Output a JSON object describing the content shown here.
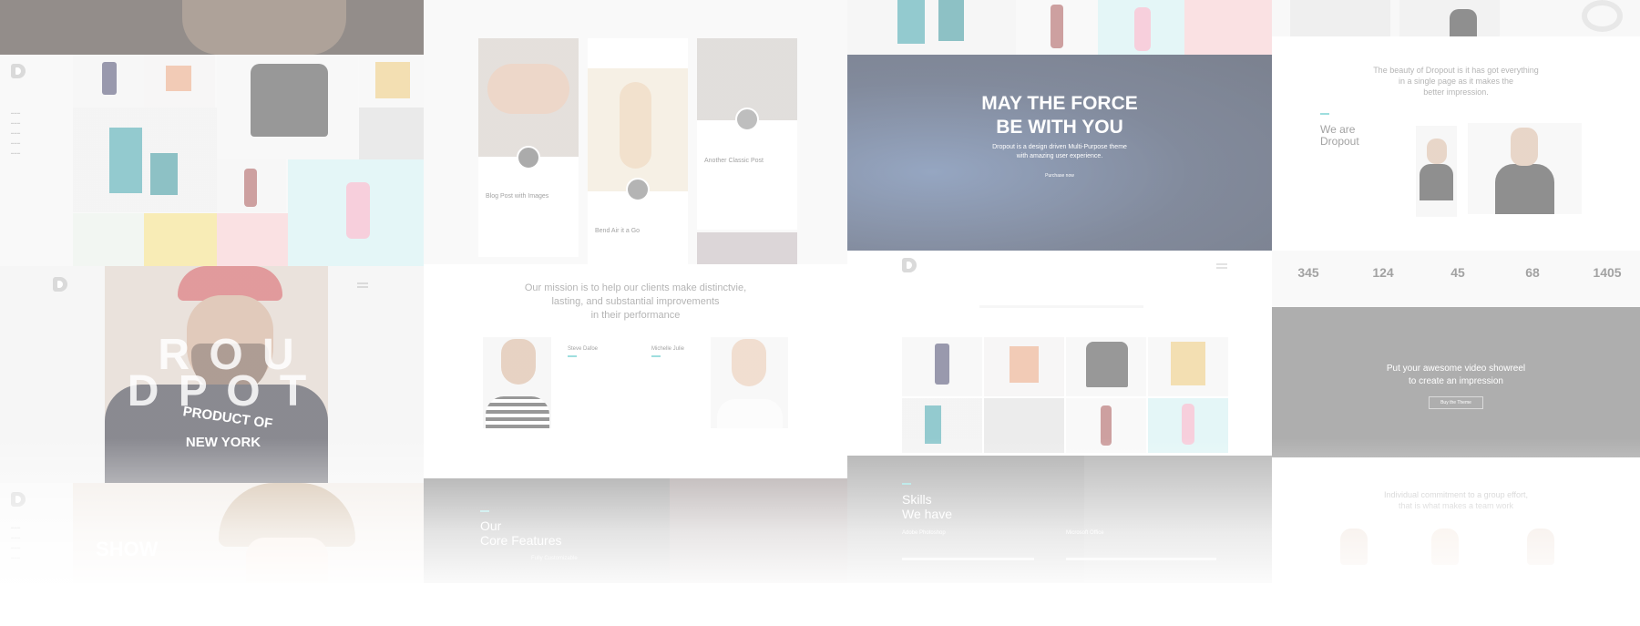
{
  "hero_panel": {
    "title_line1": "MAY THE FORCE",
    "title_line2": "BE WITH YOU",
    "subtitle_line1": "Dropout is a design driven Multi-Purpose theme",
    "subtitle_line2": "with amazing user experience.",
    "cta": "Purchase now"
  },
  "about_panel": {
    "intro_line1": "The beauty of Dropout is it has got everything",
    "intro_line2": "in a single page as it makes the",
    "intro_line3": "better impression.",
    "heading_line1": "We are",
    "heading_line2": "Dropout"
  },
  "stats": [
    "345",
    "124",
    "45",
    "68",
    "1405"
  ],
  "video_panel": {
    "line1": "Put your awesome video showreel",
    "line2": "to create an impression",
    "button": "Buy the Theme"
  },
  "team_panel": {
    "line1": "Individual commitment to a group effort,",
    "line2": "that is what makes a team work"
  },
  "mission_panel": {
    "line1": "Our mission is to help our clients make distinctvie,",
    "line2": "lasting, and substantial improvements",
    "line3": "in their performance",
    "person1": "Steve Dafoe",
    "person2": "Michelle Julie"
  },
  "blog_panel": {
    "post1": "Blog Post with Images",
    "post2": "Bend Air it a Go",
    "post3": "Another Classic Post"
  },
  "features_panel": {
    "heading_line1": "Our",
    "heading_line2": "Core Features",
    "item": "Fully Customizable"
  },
  "skills_panel": {
    "heading_line1": "Skills",
    "heading_line2": "We have",
    "skill1": "Adobe Photoshop",
    "skill2": "Microsoft Office"
  },
  "poster_panel": {
    "letters_row1": "R O   U",
    "letters_row2": "D   P O   T",
    "shirt_line1": "PRODUCT OF",
    "shirt_line2": "NEW YORK",
    "show": "SHOW"
  },
  "colors": {
    "teal": "#4ec3c4",
    "pink": "#f6c9cc",
    "mint": "#cdeff0",
    "space": "#1b2a4a"
  }
}
